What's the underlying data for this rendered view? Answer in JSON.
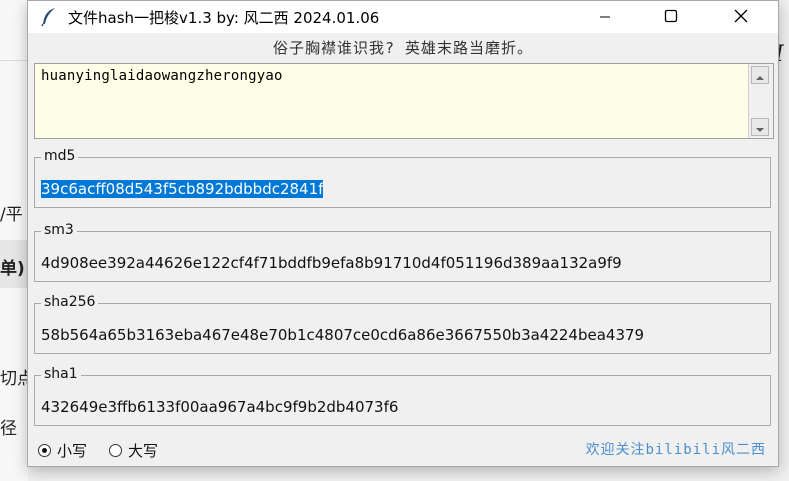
{
  "background": {
    "left_fragments": [
      "/平",
      "单)",
      "切点",
      "径"
    ],
    "right_glyph": "I"
  },
  "window": {
    "title": "文件hash一把梭v1.3  by: 风二西 2024.01.06",
    "icon": "feather-icon",
    "controls": {
      "minimize": "minimize-icon",
      "maximize": "maximize-icon",
      "close": "close-icon"
    }
  },
  "motto": "俗子胸襟谁识我? 英雄末路当磨折。",
  "input": {
    "value": "huanyinglaidaowangzherongyao"
  },
  "hashes": [
    {
      "label": "md5",
      "value": "39c6acff08d543f5cb892bdbbdc2841f",
      "selected": true
    },
    {
      "label": "sm3",
      "value": "4d908ee392a44626e122cf4f71bddfb9efa8b91710d4f051196d389aa132a9f9",
      "selected": false
    },
    {
      "label": "sha256",
      "value": "58b564a65b3163eba467e48e70b1c4807ce0cd6a86e3667550b3a4224bea4379",
      "selected": false
    },
    {
      "label": "sha1",
      "value": "432649e3ffb6133f00aa967a4bc9f9b2db4073f6",
      "selected": false
    }
  ],
  "case_options": {
    "lower": "小写",
    "upper": "大写",
    "selected": "lower"
  },
  "credit": "欢迎关注bilibili风二西",
  "colors": {
    "selection": "#0078d7",
    "input_bg": "#fefee6",
    "credit": "#4a8fd0"
  }
}
